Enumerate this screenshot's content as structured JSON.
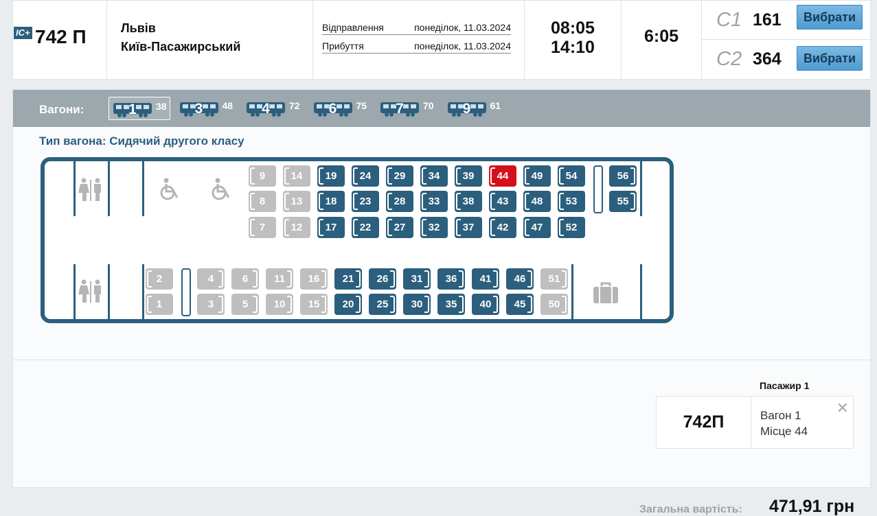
{
  "train": {
    "badge": "IC+",
    "number": "742 П",
    "from": "Львів",
    "to": "Київ-Пасажирський",
    "departure_label": "Відправлення",
    "departure_date": "понеділок, 11.03.2024",
    "arrival_label": "Прибуття",
    "arrival_date": "понеділок, 11.03.2024",
    "departure_time": "08:05",
    "arrival_time": "14:10",
    "duration": "6:05",
    "classes": [
      {
        "code": "С1",
        "free": "161",
        "button": "Вибрати"
      },
      {
        "code": "С2",
        "free": "364",
        "button": "Вибрати"
      }
    ]
  },
  "wagons": {
    "label": "Вагони:",
    "list": [
      {
        "number": "1",
        "free": "38",
        "active": true
      },
      {
        "number": "3",
        "free": "48",
        "active": false
      },
      {
        "number": "4",
        "free": "72",
        "active": false
      },
      {
        "number": "6",
        "free": "75",
        "active": false
      },
      {
        "number": "7",
        "free": "70",
        "active": false
      },
      {
        "number": "9",
        "free": "61",
        "active": false
      }
    ]
  },
  "wagon_type": "Тип вагона: Сидячий другого класу",
  "seat_map": {
    "upper_rows": [
      [
        "9",
        "14",
        "19",
        "24",
        "29",
        "34",
        "39",
        "44",
        "49",
        "54"
      ],
      [
        "8",
        "13",
        "18",
        "23",
        "28",
        "33",
        "38",
        "43",
        "48",
        "53"
      ],
      [
        "7",
        "12",
        "17",
        "22",
        "27",
        "32",
        "37",
        "42",
        "47",
        "52"
      ]
    ],
    "upper_end": [
      "56",
      "55"
    ],
    "lower_left": [
      "2",
      "1"
    ],
    "lower_rows": [
      [
        "4",
        "6",
        "11",
        "16",
        "21",
        "26",
        "31",
        "36",
        "41",
        "46",
        "51"
      ],
      [
        "3",
        "5",
        "10",
        "15",
        "20",
        "25",
        "30",
        "35",
        "40",
        "45",
        "50"
      ]
    ],
    "taken": [
      "1",
      "2",
      "3",
      "4",
      "5",
      "6",
      "7",
      "8",
      "9",
      "10",
      "11",
      "12",
      "13",
      "14",
      "15",
      "16",
      "50",
      "51"
    ],
    "selected": "44"
  },
  "passenger": {
    "title": "Пасажир 1",
    "train": "742П",
    "wagon": "Вагон 1",
    "seat": "Місце 44"
  },
  "total": {
    "label": "Загальна вартість:",
    "value": "471,91 грн"
  },
  "colors": {
    "primary": "#2b5f7d",
    "selected": "#d4111b",
    "taken": "#bfbfbf",
    "button": "#5ea7d9"
  }
}
